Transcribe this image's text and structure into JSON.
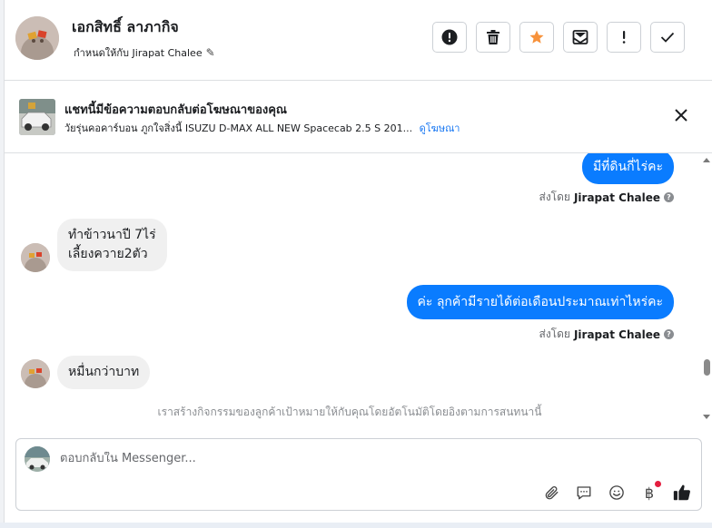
{
  "header": {
    "contact_name": "เอกสิทธิ์ ลาภากิจ",
    "assign_label": "กำหนดให้กับ Jirapat Chalee",
    "actions": [
      "report",
      "delete",
      "star",
      "mark-unread",
      "spam",
      "done"
    ]
  },
  "ad_banner": {
    "title": "แชทนี้มีข้อความตอบกลับต่อโฆษณาของคุณ",
    "description": "วัยรุ่นคอคาร์บอน ภูกใจสิ่งนี้ ISUZU D-MAX ALL NEW Spacecab 2.5 S 201...",
    "link_label": "ดูโฆษณา"
  },
  "messages": [
    {
      "direction": "out",
      "text": "มีที่ดินกี่ไร่คะ",
      "sent_by_prefix": "ส่งโดย",
      "sent_by_name": "Jirapat Chalee"
    },
    {
      "direction": "in",
      "lines": [
        "ทำข้าวนาปี 7ไร่",
        "เลี้ยงควาย2ตัว"
      ]
    },
    {
      "direction": "out",
      "text": "ค่ะ ลุกค้ามีรายได้ต่อเดือนประมาณเท่าไหร่คะ",
      "sent_by_prefix": "ส่งโดย",
      "sent_by_name": "Jirapat Chalee"
    },
    {
      "direction": "in",
      "lines": [
        "หมื่นกว่าบาท"
      ]
    }
  ],
  "system_note": "เราสร้างกิจกรรมของลูกค้าเป้าหมายให้กับคุณโดยอัตโนมัติโดยอิงตามการสนทนานี้",
  "composer": {
    "placeholder": "ตอบกลับใน Messenger...",
    "currency_symbol": "฿"
  },
  "colors": {
    "accent": "#0a7cff",
    "star": "#f7923b",
    "incoming_bubble": "#f0f0f0",
    "notification": "#e41e3f"
  }
}
